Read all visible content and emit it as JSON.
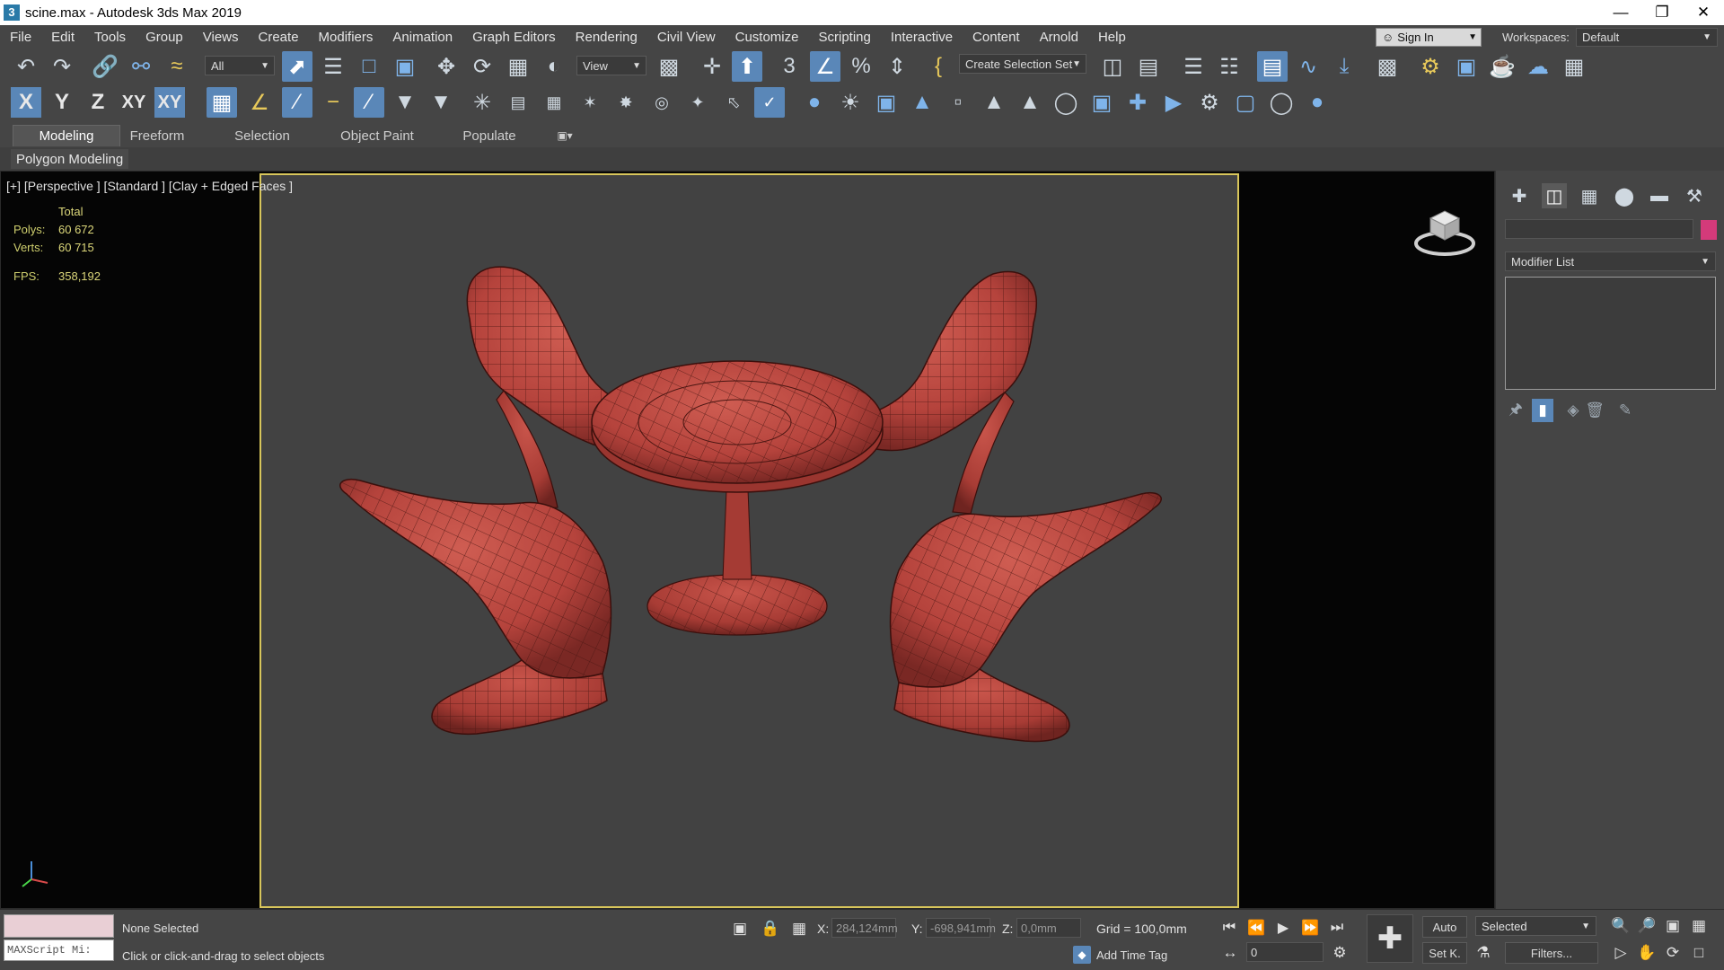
{
  "window": {
    "title": "scine.max - Autodesk 3ds Max 2019",
    "app_icon": "3ds-max-icon",
    "controls": [
      "minimize-icon",
      "restore-icon",
      "close-icon"
    ]
  },
  "menu": {
    "items": [
      "File",
      "Edit",
      "Tools",
      "Group",
      "Views",
      "Create",
      "Modifiers",
      "Animation",
      "Graph Editors",
      "Rendering",
      "Civil View",
      "Customize",
      "Scripting",
      "Interactive",
      "Content",
      "Arnold",
      "Help"
    ],
    "sign_in": "Sign In",
    "workspaces_label": "Workspaces:",
    "workspace_value": "Default"
  },
  "toolbar": {
    "selection_filter": "All",
    "ref_coord": "View",
    "named_selection": "Create Selection Set",
    "axis_constraints": [
      "X",
      "Y",
      "Z",
      "XY",
      "XY"
    ]
  },
  "ribbon": {
    "tabs": [
      "Modeling",
      "Freeform",
      "Selection",
      "Object Paint",
      "Populate"
    ],
    "active_tab": "Modeling",
    "panel_label": "Polygon Modeling"
  },
  "viewport": {
    "label": "[+] [Perspective ] [Standard ] [Clay + Edged Faces ]",
    "stats": {
      "total_label": "Total",
      "polys_label": "Polys:",
      "polys_value": "60 672",
      "verts_label": "Verts:",
      "verts_value": "60 715",
      "fps_label": "FPS:",
      "fps_value": "358,192"
    },
    "colors": {
      "border": "#d8c65b",
      "background": "#424242",
      "object": "#b5433c"
    }
  },
  "command_panel": {
    "tabs": [
      "create-icon",
      "modify-icon",
      "hierarchy-icon",
      "motion-icon",
      "display-icon",
      "utilities-icon"
    ],
    "object_color": "#d43a7a",
    "modifier_list": "Modifier List"
  },
  "status": {
    "listener_placeholder": "MAXScript Mi:",
    "selection": "None Selected",
    "prompt": "Click or click-and-drag to select objects",
    "x_label": "X:",
    "x_value": "284,124mm",
    "y_label": "Y:",
    "y_value": "-698,941mm",
    "z_label": "Z:",
    "z_value": "0,0mm",
    "grid": "Grid = 100,0mm",
    "add_time_tag": "Add Time Tag",
    "frame": "0",
    "auto_key": "Auto",
    "set_key": "Set K.",
    "key_filter": "Selected",
    "filters": "Filters..."
  }
}
